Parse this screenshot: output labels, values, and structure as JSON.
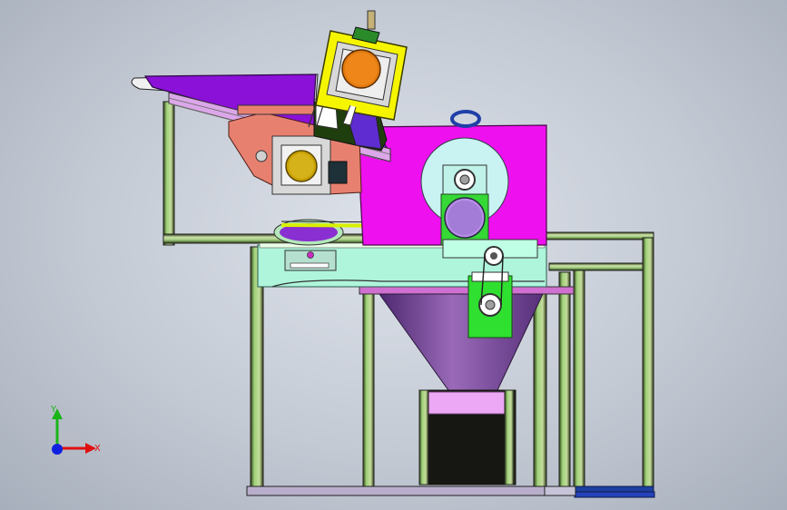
{
  "triad": {
    "x_label": "X",
    "y_label": "Y",
    "x_color": "#e01010",
    "y_color": "#18b418",
    "z_color": "#1020e0"
  },
  "colors": {
    "frame_dark": "#2c3a14",
    "frame_green": "#8fca6a",
    "frame_olive": "#b6c98a",
    "hopper_purple": "#8b10d8",
    "housing_magenta": "#ee10ee",
    "bed_mint": "#aef5dc",
    "motor_yellow": "#f5f500",
    "bracket_green": "#30e030",
    "bracket_salmon": "#e88070",
    "bearing_orange": "#e07a10",
    "funnel_violet": "#6a3c86",
    "bin_pink": "#eca8f4",
    "bin_black": "#161612",
    "wheel_cyan": "#c9f2f2"
  }
}
